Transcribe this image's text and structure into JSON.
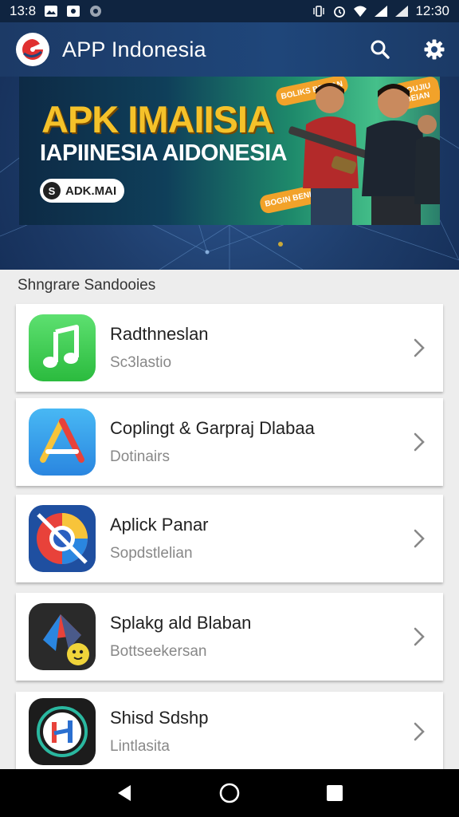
{
  "status_bar": {
    "left_time": "13:8",
    "right_time": "12:30",
    "left_icons": [
      "gallery-icon",
      "photo-icon",
      "chat-icon"
    ],
    "right_icons": [
      "vibrate-icon",
      "alarm-icon",
      "wifi-icon",
      "signal-icon",
      "signal-icon"
    ]
  },
  "app_bar": {
    "title": "APP Indonesia",
    "actions": [
      "search-icon",
      "settings-icon"
    ]
  },
  "banner": {
    "title": "APK IMAIISIA",
    "subtitle": "IAPIINESIA AIDONESIA",
    "pill_label": "ADK.MAI",
    "badge_top": "BOLIKS BERIAN",
    "badge_top_right": "BOUJIU BEIAN",
    "badge_bottom": "BOGIN BENIN"
  },
  "section": {
    "title": "Shngrare Sandooies"
  },
  "items": [
    {
      "title": "Radthneslan",
      "subtitle": "Sc3lastio",
      "icon": "music-icon"
    },
    {
      "title": "Coplingt & Garpraj Dlabaa",
      "subtitle": "Dotinairs",
      "icon": "app-store-icon"
    },
    {
      "title": "Aplick Panar",
      "subtitle": "Sopdstlelian",
      "icon": "browser-icon"
    },
    {
      "title": "Splakg ald Blaban",
      "subtitle": "Bottseekersan",
      "icon": "game-icon"
    },
    {
      "title": "Shisd Sdshp",
      "subtitle": "Lintlasita",
      "icon": "media-icon"
    }
  ],
  "nav": [
    "back-icon",
    "home-icon",
    "recents-icon"
  ],
  "colors": {
    "app_bar": "#1f467a",
    "status_bar": "#0f2440",
    "banner_gold": "#f5c22a",
    "badge": "#f2a22a"
  }
}
